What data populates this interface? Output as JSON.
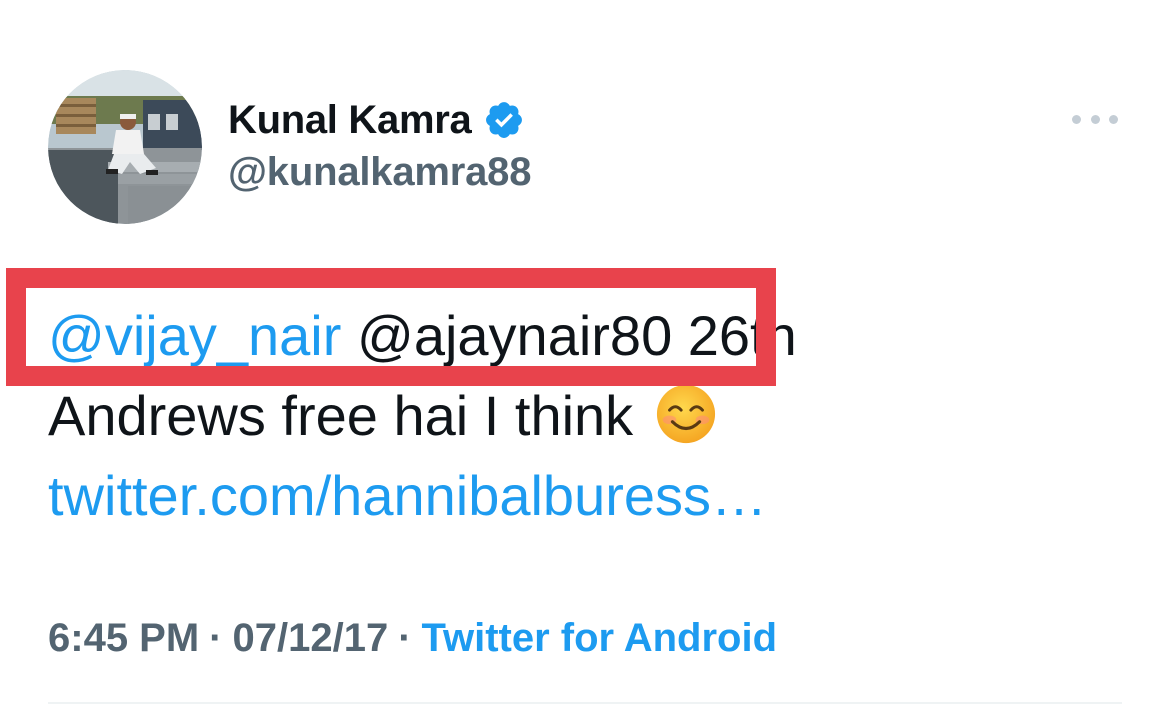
{
  "author": {
    "name": "Kunal Kamra",
    "handle": "@kunalkamra88",
    "verified": true
  },
  "tweet": {
    "mention_1": "@vijay_nair",
    "line1_rest": " @ajaynair80 26th",
    "line2": "Andrews free hai I think ",
    "emoji": "smiling-face-with-smiling-eyes",
    "link": "twitter.com/hannibalburess…"
  },
  "meta": {
    "time": "6:45 PM",
    "separator": "·",
    "date": "07/12/17",
    "source": "Twitter for Android"
  },
  "colors": {
    "accent": "#1d9bf0",
    "text": "#0f1419",
    "secondary": "#536471",
    "annotation_box": "#e8434c"
  },
  "icons": {
    "verified": "verified-badge-icon",
    "more": "more-options-icon"
  }
}
